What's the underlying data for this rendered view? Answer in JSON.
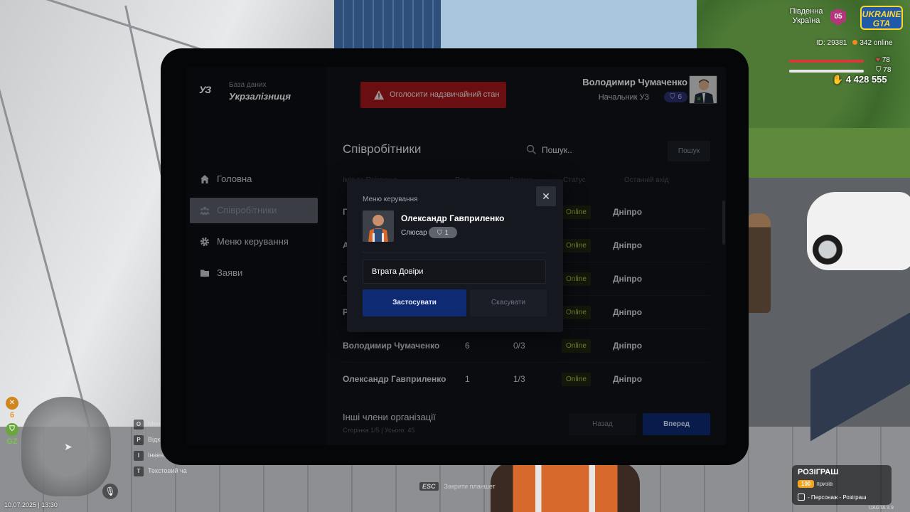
{
  "hud": {
    "region_line1": "Південна",
    "region_line2": "Україна",
    "region_badge": "05",
    "logo_line1": "UKRAINE",
    "logo_line2": "GTA",
    "player_id": "ID: 29381",
    "online": "342 online",
    "health": "78",
    "armor": "78",
    "money": "4 428 555",
    "side_level": "6",
    "side_gz": "GZ",
    "keys": [
      {
        "key": "O",
        "label": "Мен"
      },
      {
        "key": "P",
        "label": "Відк"
      },
      {
        "key": "I",
        "label": "Інвент"
      },
      {
        "key": "T",
        "label": "Текстовий ча"
      }
    ],
    "datetime": "10.07.2025 | 13:30",
    "esc_key": "ESC",
    "esc_label": "Закрити планшет",
    "raffle_title": "РОЗІГРАШ",
    "raffle_count": "100",
    "raffle_prizes": "призів",
    "raffle_link": "Персонаж - Розіграш",
    "version": "UAGTA 3.9"
  },
  "tablet": {
    "brand_logo": "УЗ",
    "brand_sub": "База даних",
    "brand_name": "Укрзалізниця",
    "nav": [
      {
        "label": "Головна",
        "icon": "home-icon",
        "active": false
      },
      {
        "label": "Співробітники",
        "icon": "people-icon",
        "active": true
      },
      {
        "label": "Меню керування",
        "icon": "gear-icon",
        "active": false
      },
      {
        "label": "Заяви",
        "icon": "folder-icon",
        "active": false
      }
    ],
    "alert_button": "Оголосити надзвичайний стан",
    "user": {
      "name": "Володимир Чумаченко",
      "role": "Начальник УЗ",
      "rank": "6"
    },
    "section_title": "Співробітники",
    "search_placeholder": "Пошук..",
    "search_button": "Пошук",
    "columns": [
      "Ім'я та Прізвище",
      "Ранг",
      "Догани",
      "Статус",
      "Останній вхід"
    ],
    "rows": [
      {
        "name": "Г",
        "rank": "",
        "warn": "",
        "status": "Online",
        "city": "Дніпро"
      },
      {
        "name": "А",
        "rank": "",
        "warn": "",
        "status": "Online",
        "city": "Дніпро"
      },
      {
        "name": "О",
        "rank": "",
        "warn": "",
        "status": "Online",
        "city": "Дніпро"
      },
      {
        "name": "Р",
        "rank": "",
        "warn": "",
        "status": "Online",
        "city": "Дніпро"
      },
      {
        "name": "Володимир Чумаченко",
        "rank": "6",
        "warn": "0/3",
        "status": "Online",
        "city": "Дніпро"
      },
      {
        "name": "Олександр Гавприленко",
        "rank": "1",
        "warn": "1/3",
        "status": "Online",
        "city": "Дніпро"
      }
    ],
    "other_title": "Інші члени організації",
    "pager_info": "Сторінка 1/5 | Усього: 45",
    "back_button": "Назад",
    "next_button": "Вперед"
  },
  "modal": {
    "title": "Меню керування",
    "close": "✕",
    "name": "Олександр Гавприленко",
    "role": "Слюсар",
    "rank": "1",
    "input_value": "Втрата Довіри",
    "apply_button": "Застосувати",
    "cancel_button": "Скасувати"
  },
  "colors": {
    "alert": "#a4161c",
    "primary": "#0d2a73",
    "online_text": "#a9c04a"
  }
}
